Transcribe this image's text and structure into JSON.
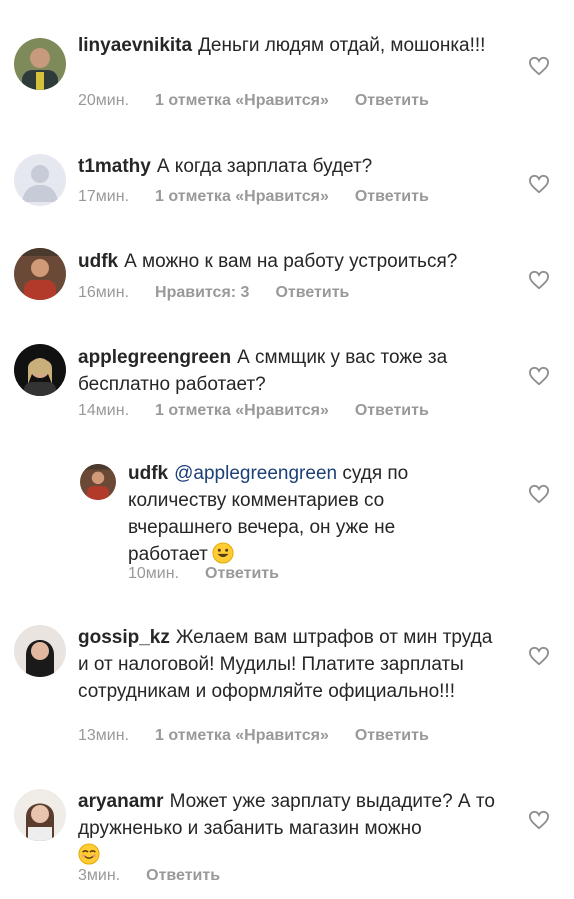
{
  "comments": [
    {
      "user": "linyaevnikita",
      "text": "Деньги людям отдай, мошонка!!!",
      "time": "20мин.",
      "likes": "1 отметка «Нравится»",
      "reply": "Ответить"
    },
    {
      "user": "t1mathy",
      "text": "А когда зарплата будет?",
      "time": "17мин.",
      "likes": "1 отметка «Нравится»",
      "reply": "Ответить"
    },
    {
      "user": "udfk",
      "text": "А можно к вам на работу устроиться?",
      "time": "16мин.",
      "likes": "Нравится: 3",
      "reply": "Ответить"
    },
    {
      "user": "applegreengreen",
      "text": "А сммщик у вас тоже за бесплатно работает?",
      "time": "14мин.",
      "likes": "1 отметка «Нравится»",
      "reply": "Ответить"
    },
    {
      "user": "udfk",
      "mention": "@applegreengreen",
      "text": "судя по количеству комментариев со вчерашнего вечера, он уже не работает",
      "emoji": "smiling-face-emoji",
      "time": "10мин.",
      "reply": "Ответить"
    },
    {
      "user": "gossip_kz",
      "text": "Желаем вам штрафов от мин труда и от налоговой! Мудилы! Платите зарплаты сотрудникам и оформляйте официально!!!",
      "time": "13мин.",
      "likes": "1 отметка «Нравится»",
      "reply": "Ответить"
    },
    {
      "user": "aryanamr",
      "text": "Может уже зарплату выдадите? А то дружненько и забанить магазин можно",
      "emoji": "smiling-face-emoji",
      "time": "3мин.",
      "reply": "Ответить"
    }
  ],
  "colors": {
    "text": "#262626",
    "meta": "#999999",
    "mention": "#1c3f78"
  },
  "icons": {
    "like": "heart-outline-icon"
  }
}
